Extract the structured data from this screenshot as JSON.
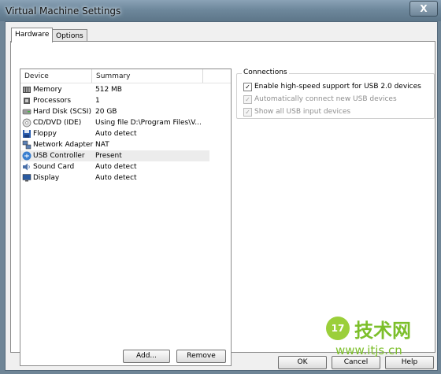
{
  "window": {
    "title": "Virtual Machine Settings",
    "close_glyph": "X"
  },
  "tabs": [
    {
      "label": "Hardware",
      "active": true
    },
    {
      "label": "Options",
      "active": false
    }
  ],
  "device_list": {
    "columns": [
      "Device",
      "Summary"
    ],
    "rows": [
      {
        "device": "Memory",
        "summary": "512 MB",
        "icon": "memory-icon"
      },
      {
        "device": "Processors",
        "summary": "1",
        "icon": "processor-icon"
      },
      {
        "device": "Hard Disk (SCSI)",
        "summary": "20 GB",
        "icon": "hard-disk-icon"
      },
      {
        "device": "CD/DVD (IDE)",
        "summary": "Using file D:\\Program Files\\V...",
        "icon": "cd-dvd-icon"
      },
      {
        "device": "Floppy",
        "summary": "Auto detect",
        "icon": "floppy-icon"
      },
      {
        "device": "Network Adapter",
        "summary": "NAT",
        "icon": "network-adapter-icon"
      },
      {
        "device": "USB Controller",
        "summary": "Present",
        "icon": "usb-icon",
        "selected": true
      },
      {
        "device": "Sound Card",
        "summary": "Auto detect",
        "icon": "sound-card-icon"
      },
      {
        "device": "Display",
        "summary": "Auto detect",
        "icon": "display-icon"
      }
    ]
  },
  "list_buttons": {
    "add": "Add...",
    "remove": "Remove"
  },
  "connections": {
    "title": "Connections",
    "options": [
      {
        "label": "Enable high-speed support for USB 2.0 devices",
        "checked": true,
        "enabled": true
      },
      {
        "label": "Automatically connect new USB devices",
        "checked": true,
        "enabled": false
      },
      {
        "label": "Show all USB input devices",
        "checked": true,
        "enabled": false
      }
    ]
  },
  "footer": {
    "ok": "OK",
    "cancel": "Cancel",
    "help": "Help"
  },
  "watermark": {
    "badge": "17",
    "text": "技术网",
    "url": "www.itjs.cn"
  }
}
